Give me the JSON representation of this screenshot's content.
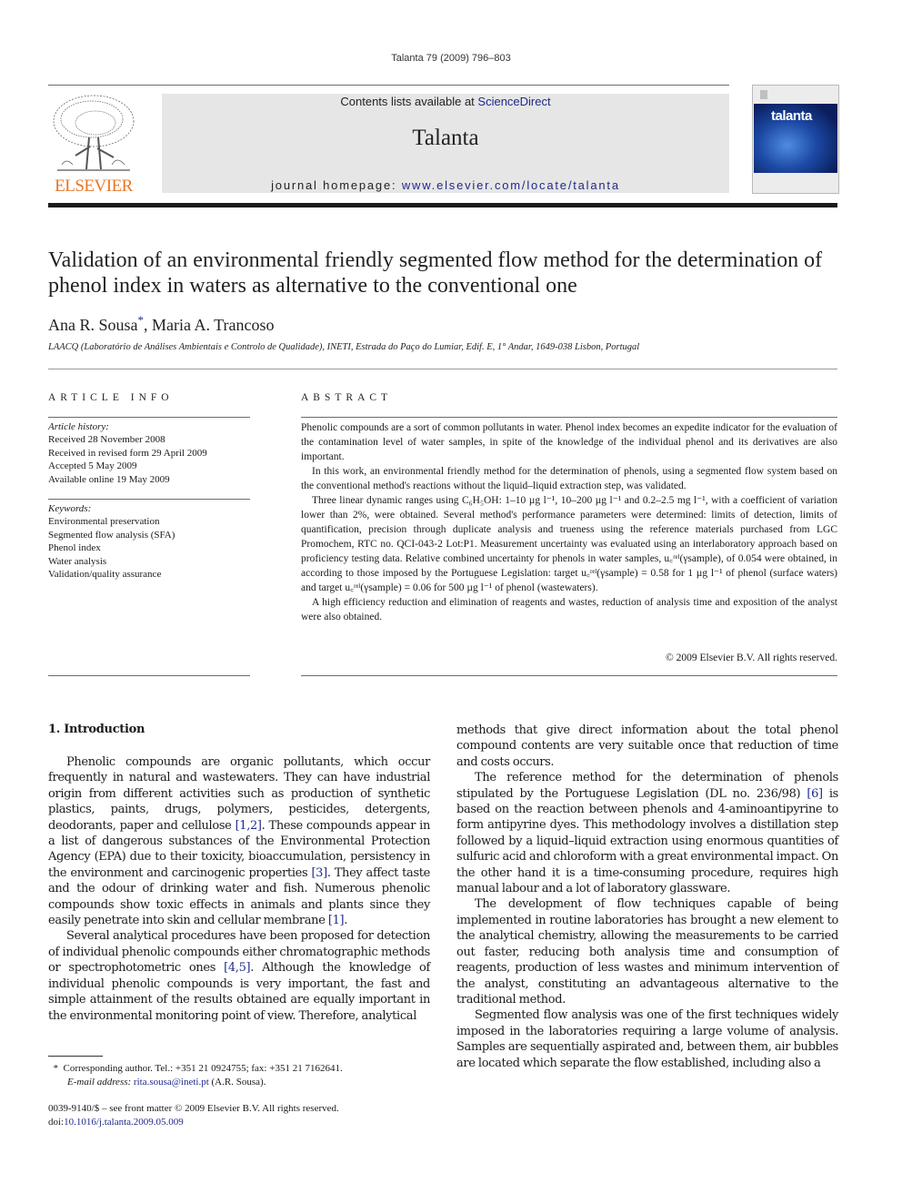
{
  "running_head": "Talanta 79 (2009) 796–803",
  "banner": {
    "contents_prefix": "Contents lists available at ",
    "contents_link": "ScienceDirect",
    "journal_name": "Talanta",
    "homepage_prefix": "journal homepage: ",
    "homepage_link": "www.elsevier.com/locate/talanta"
  },
  "publisher_logo_text": "ELSEVIER",
  "cover_title": "talanta",
  "colors": {
    "elsevier_orange": "#e87722",
    "link_blue": "#1f2a8a",
    "banner_gray": "#e6e6e6"
  },
  "article": {
    "title": "Validation of an environmental friendly segmented flow method for the determination of phenol index in waters as alternative to the conventional one",
    "authors": [
      {
        "name": "Ana R. Sousa",
        "mark": "*"
      },
      {
        "name": "Maria A. Trancoso",
        "mark": ""
      }
    ],
    "author_separator": ", ",
    "affiliation": "LAACQ (Laboratório de Análises Ambientais e Controlo de Qualidade), INETI, Estrada do Paço do Lumiar, Edif. E, 1° Andar, 1649-038 Lisbon, Portugal"
  },
  "article_info": {
    "heading": "ARTICLE INFO",
    "history_label": "Article history:",
    "history": [
      "Received 28 November 2008",
      "Received in revised form 29 April 2009",
      "Accepted 5 May 2009",
      "Available online 19 May 2009"
    ],
    "keywords_label": "Keywords:",
    "keywords": [
      "Environmental preservation",
      "Segmented flow analysis (SFA)",
      "Phenol index",
      "Water analysis",
      "Validation/quality assurance"
    ]
  },
  "abstract": {
    "heading": "ABSTRACT",
    "p1": "Phenolic compounds are a sort of common pollutants in water. Phenol index becomes an expedite indicator for the evaluation of the contamination level of water samples, in spite of the knowledge of the individual phenol and its derivatives are also important.",
    "p2": "In this work, an environmental friendly method for the determination of phenols, using a segmented flow system based on the conventional method's reactions without the liquid–liquid extraction step, was validated.",
    "p3": "Three linear dynamic ranges using C₆H₅OH: 1–10 µg l⁻¹, 10–200 µg l⁻¹ and 0.2–2.5 mg l⁻¹, with a coefficient of variation lower than 2%, were obtained. Several method's performance parameters were determined: limits of detection, limits of quantification, precision through duplicate analysis and trueness using the reference materials purchased from LGC Promochem, RTC no. QCI-043-2 Lot:P1. Measurement uncertainty was evaluated using an interlaboratory approach based on proficiency testing data. Relative combined uncertainty for phenols in water samples, u꜀ʳᵉˡ(γsample), of 0.054 were obtained, in according to those imposed by the Portuguese Legislation: target u꜀ʳᵉˡ(γsample) = 0.58 for 1 µg l⁻¹ of phenol (surface waters) and target u꜀ʳᵉˡ(γsample) = 0.06 for 500 µg l⁻¹ of phenol (wastewaters).",
    "p4": "A high efficiency reduction and elimination of reagents and wastes, reduction of analysis time and exposition of the analyst were also obtained.",
    "copyright": "© 2009 Elsevier B.V. All rights reserved."
  },
  "body": {
    "section_heading": "1.  Introduction",
    "left": {
      "p1_a": "Phenolic compounds are organic pollutants, which occur frequently in natural and wastewaters. They can have industrial origin from different activities such as production of synthetic plastics, paints, drugs, polymers, pesticides, detergents, deodorants, paper and cellulose ",
      "p1_ref1": "[1,2]",
      "p1_b": ". These compounds appear in a list of dangerous substances of the Environmental Protection Agency (EPA) due to their toxicity, bioaccumulation, persistency in the environment and carcinogenic properties ",
      "p1_ref2": "[3]",
      "p1_c": ". They affect taste and the odour of drinking water and fish. Numerous phenolic compounds show toxic effects in animals and plants since they easily penetrate into skin and cellular membrane ",
      "p1_ref3": "[1]",
      "p1_d": ".",
      "p2_a": "Several analytical procedures have been proposed for detection of individual phenolic compounds either chromatographic methods or spectrophotometric ones ",
      "p2_ref": "[4,5]",
      "p2_b": ". Although the knowledge of individual phenolic compounds is very important, the fast and simple attainment of the results obtained are equally important in the environmental monitoring point of view. Therefore, analytical"
    },
    "right": {
      "p0": "methods that give direct information about the total phenol compound contents are very suitable once that reduction of time and costs occurs.",
      "p1_a": "The reference method for the determination of phenols stipulated by the Portuguese Legislation (DL no. 236/98) ",
      "p1_ref": "[6]",
      "p1_b": " is based on the reaction between phenols and 4-aminoantipyrine to form antipyrine dyes. This methodology involves a distillation step followed by a liquid–liquid extraction using enormous quantities of sulfuric acid and chloroform with a great environmental impact. On the other hand it is a time-consuming procedure, requires high manual labour and a lot of laboratory glassware.",
      "p2": "The development of flow techniques capable of being implemented in routine laboratories has brought a new element to the analytical chemistry, allowing the measurements to be carried out faster, reducing both analysis time and consumption of reagents, production of less wastes and minimum intervention of the analyst, constituting an advantageous alternative to the traditional method.",
      "p3": "Segmented flow analysis was one of the first techniques widely imposed in the laboratories requiring a large volume of analysis. Samples are sequentially aspirated and, between them, air bubbles are located which separate the flow established, including also a"
    }
  },
  "footnote": {
    "mark": "*",
    "corresponding": "Corresponding author. Tel.: +351 21 0924755; fax: +351 21 7162641.",
    "email_label": "E-mail address:",
    "email": "rita.sousa@ineti.pt",
    "email_suffix": " (A.R. Sousa)."
  },
  "front_matter": {
    "issn_line": "0039-9140/$ – see front matter © 2009 Elsevier B.V. All rights reserved.",
    "doi_label": "doi:",
    "doi": "10.1016/j.talanta.2009.05.009"
  }
}
